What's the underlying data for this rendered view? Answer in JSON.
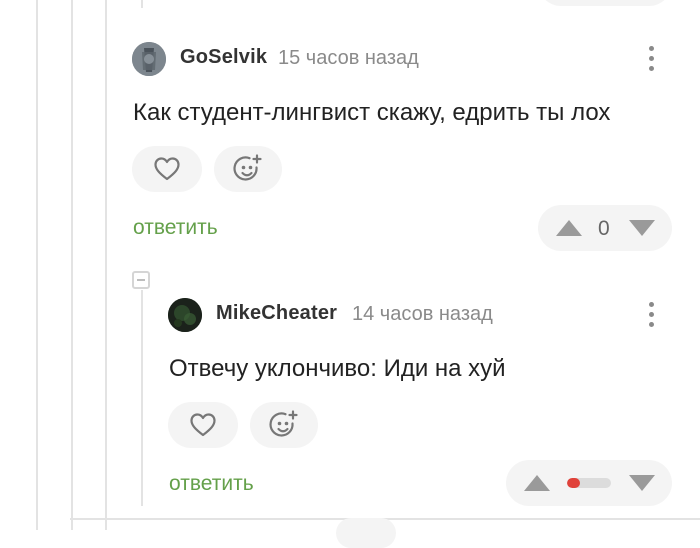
{
  "comments": [
    {
      "author": "GoSelvik",
      "time": "15 часов назад",
      "text": "Как студент-лингвист скажу, едрить ты лох",
      "reply_label": "ответить",
      "rating": "0",
      "avatar_icon": "user-avatar"
    },
    {
      "author": "MikeCheater",
      "time": "14 часов назад",
      "text": "Отвечу уклончиво: Иди на хуй",
      "reply_label": "ответить",
      "rating_bar_fraction": 0.3,
      "avatar_icon": "user-avatar"
    }
  ],
  "icons": {
    "like": "heart-icon",
    "reaction": "add-emoji-icon",
    "more": "more-vertical-icon",
    "upvote": "arrow-up-icon",
    "downvote": "arrow-down-icon",
    "collapse": "minus-square-icon"
  },
  "colors": {
    "reply_link": "#64a04a",
    "rating_negative": "#e0423a",
    "button_bg": "#f4f4f4"
  }
}
